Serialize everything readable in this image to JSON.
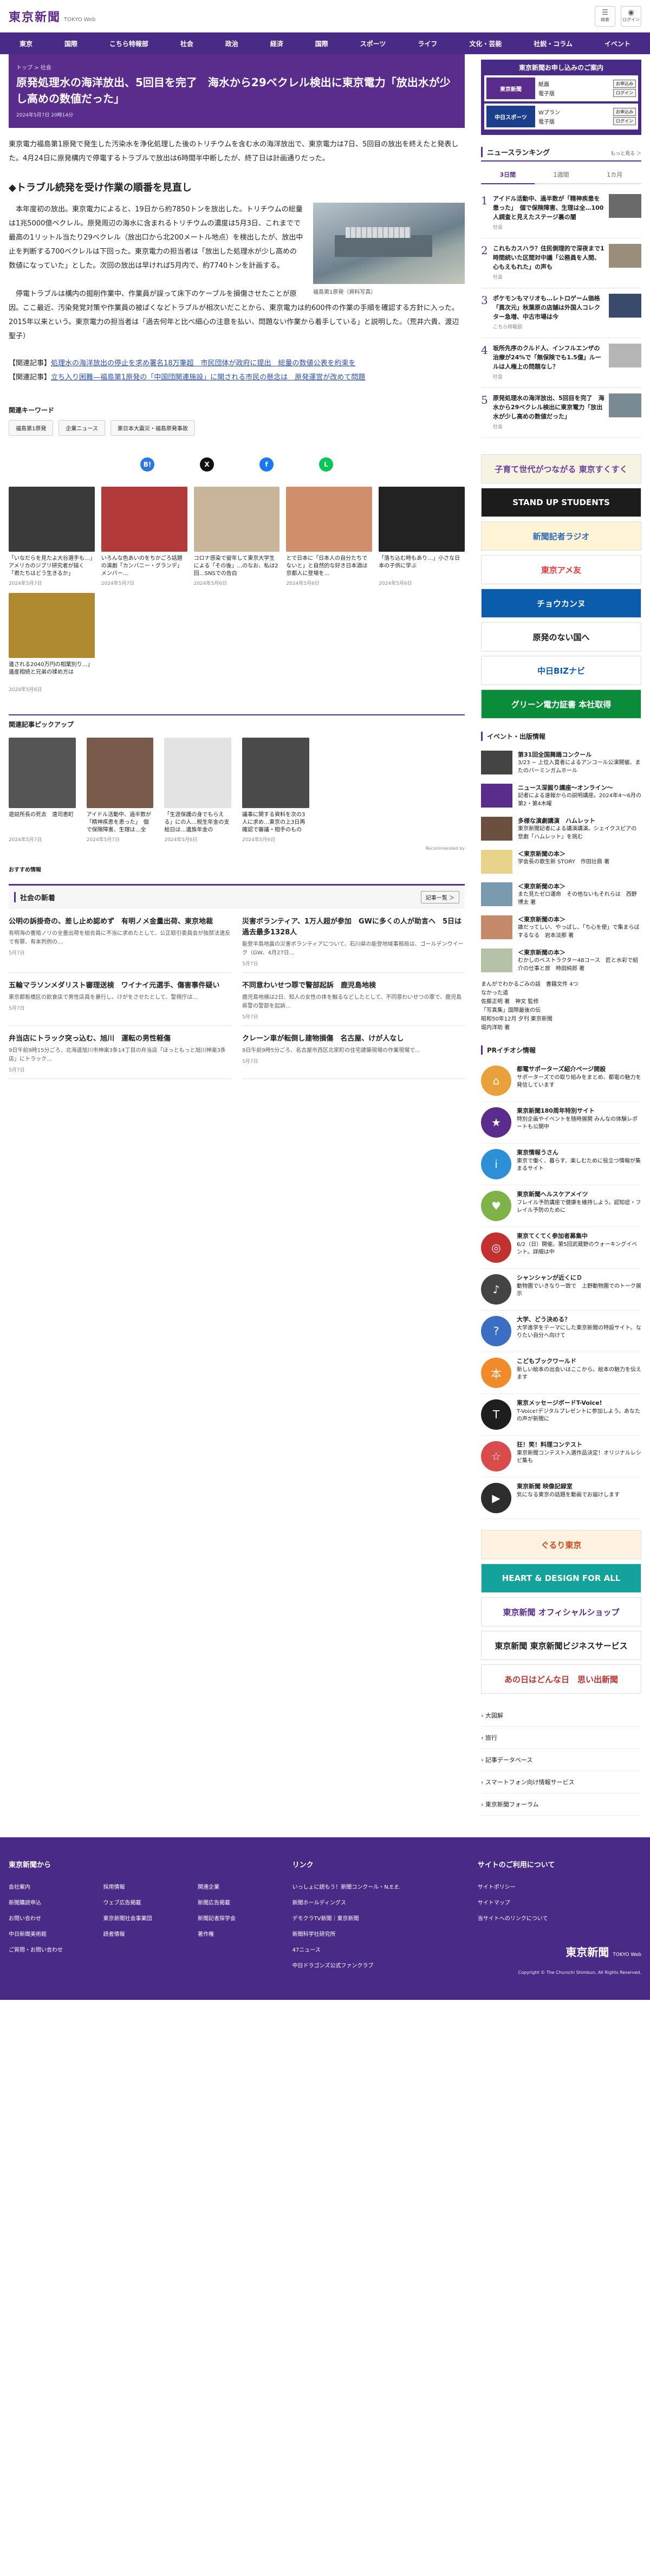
{
  "header": {
    "logo": "東京新聞",
    "logo_sub": "TOKYO Web",
    "icons": [
      {
        "glyph": "☰",
        "label": "検索"
      },
      {
        "glyph": "◉",
        "label": "ログイン"
      }
    ]
  },
  "nav": [
    "東京",
    "国際",
    "こちら特報部",
    "社会",
    "政治",
    "経済",
    "国際",
    "スポーツ",
    "ライフ",
    "文化・芸能",
    "社説・コラム",
    "イベント"
  ],
  "article": {
    "breadcrumb": "トップ > 社会",
    "title": "原発処理水の海洋放出、5回目を完了　海水から29ベクレル検出に東京電力「放出水が少し高めの数値だった」",
    "date": "2024年5月7日 20時14分",
    "lead": "東京電力福島第1原発で発生した汚染水を浄化処理した後のトリチウムを含む水の海洋放出で、東京電力は7日、5回目の放出を終えたと発表した。4月24日に原発構内で停電するトラブルで放出は6時間半中断したが、終了日は計画通りだった。",
    "section": "◆トラブル続発を受け作業の順番を見直し",
    "para1": "本年度初の放出。東京電力によると、19日から約7850トンを放出した。トリチウムの総量は1兆5000億ベクレル。原発周辺の海水に含まれるトリチウムの濃度は5月3日、これまでで最高の1リットル当たり29ベクレル（放出口から北200メートル地点）を検出したが、放出中止を判断する700ベクレルは下回った。東京電力の担当者は「放出した処理水が少し高めの数値になっていた」とした。次回の放出は早ければ5月内で、約7740トンを計画する。",
    "para2": "停電トラブルは構内の掘削作業中、作業員が誤って床下のケーブルを損傷させたことが原因。ここ最近、汚染発覚対策や作業員の被ばくなどトラブルが相次いだことから、東京電力は約600件の作業の手順を確認する方針に入った。2015年以来という。東京電力の担当者は「過去何年と比べ細心の注意を払い、問題ない作業から着手している」と説明した。（荒井六貴、渡辺聖子）",
    "photo_caption": "福島第1原発（資料写真）",
    "related": [
      {
        "tag": "【関連記事】",
        "text": "処理水の海洋放出の停止を求め署名18万筆超　市民団体が政府に提出　総量の数値公表を約束を"
      },
      {
        "tag": "【関連記事】",
        "text": "立ち入り困難—福島第1原発の「中国団関連施設」に関される市民の懸念は　原発運営が改めて問題"
      }
    ],
    "keywords_heading": "関連キーワード",
    "keywords": [
      "福島第1原発",
      "企業ニュース",
      "東日本大震災・福島原発事故"
    ]
  },
  "share": [
    {
      "g": "B!",
      "c": "#2c7ae0"
    },
    {
      "g": "X",
      "c": "#111"
    },
    {
      "g": "f",
      "c": "#1877f2"
    },
    {
      "g": "L",
      "c": "#06c755"
    }
  ],
  "photo_cards": [
    {
      "t": "「いなだらを見たよ大谷選手も…」アメリカのジブリ研究者が描く「君たちはどう生きるか」",
      "d": "2024年5月7日",
      "c": "#3a3a3a"
    },
    {
      "t": "いろんな色あいのをちかごろ話題の演劇「カンバニー・グランデ」メンバー…",
      "d": "2024年5月7日",
      "c": "#b23a3a"
    },
    {
      "t": "コロナ感染で留年して東京大学生による「その後」…のなお、私は2回…SNSでの告白",
      "d": "2024年5月6日",
      "c": "#c8b59a"
    },
    {
      "t": "とで日本に「日本人の自分たちでないと」と自然的な好き日本酒は京都人に登場を…",
      "d": "2024年5月6日",
      "c": "#d08f6a"
    },
    {
      "t": "「落ち込む時もあり…」小さな日本の子供に学ぶ",
      "d": "2024年5月6日",
      "c": "#222"
    },
    {
      "t": "遺される2040万円の相葉別り…」遺産相続と兄弟の揉め方は",
      "d": "2024年5月6日",
      "c": "#b08a30"
    }
  ],
  "pickup": {
    "heading": "関連記事ピックアップ",
    "items": [
      {
        "t": "遊説所長の死去　遠司恵町",
        "d": "2024年5月7日",
        "c": "#555"
      },
      {
        "t": "アイドル活動中、過半数が「精神疾患を患った」　個で保険障害、生理は…全100人聞き",
        "d": "2024年5月7日",
        "c": "#7a5a4a"
      },
      {
        "t": "「生涯保護の身でもらえる」にの人…税生年金の支給日は…遺族年金の",
        "d": "2024年5月6日",
        "c": "#e3e3e3"
      },
      {
        "t": "議事に関する資料を次の3人に求め…東京の上3日再確認で審議・相手のもの",
        "d": "2024年5月6日",
        "c": "#4a4a4a"
      }
    ],
    "reco": "Recommended by"
  },
  "osusume": "おすすめ情報",
  "social": {
    "heading": "社会の新着",
    "more": "記事一覧 ＞",
    "items": [
      {
        "h": "公明の訴掛奇の、差し止め認めず　有明ノメ金量出荷、東京地裁",
        "p": "有明海の養殖ノリの全量出荷を組合員に不当に求めたとして、公正取引委員会が独禁法違反で有罪、有本判例の…",
        "d": "5月7日"
      },
      {
        "h": "災害ボランティア、1万人超が参加　GWに多くの人が助言へ　5日は過去最多1328人",
        "p": "能登半島地震の災害ボランティアについて、石川県の能登地域事務局は、ゴールデンウイーク（GW、4月27日…",
        "d": "5月7日"
      },
      {
        "h": "五輪マラソンメダリスト審理送検　ワイナイ元選手、傷害事件疑い",
        "p": "東京都板橋区の飲食店で男性店員を暴行し、けがをさせたとして、警視庁は…",
        "d": "5月7日"
      },
      {
        "h": "不同意わいせつ罪で警部起訴　鹿児島地検",
        "p": "鹿児島地検は2日、知人の女性の体を触るなどしたとして、不同意わいせつの罪で、鹿児島県警の警部を起訴…",
        "d": "5月7日"
      },
      {
        "h": "弁当店にトラック突っ込む、旭川　運転の男性軽傷",
        "p": "9日午前9時15分ごろ、北海道旭川市神楽3条14丁目の弁当店「ほっともっと旭川神楽3条店」にトラック…",
        "d": "5月7日"
      },
      {
        "h": "クレーン車が転倒し建物損傷　名古屋、けが人なし",
        "p": "9日午前9時5分ごろ、名古屋市西区北家町の住宅建築現場の作業現場で…",
        "d": "5月7日"
      }
    ]
  },
  "side": {
    "banner": {
      "title": "東京新聞お申し込みのご案内",
      "rows": [
        {
          "logo": "東京新聞",
          "opts": [
            {
              "n": "紙面",
              "b": "お申込み"
            },
            {
              "n": "電子版",
              "b": "ログイン"
            }
          ]
        },
        {
          "logo": "中日スポーツ",
          "opts": [
            {
              "n": "Wプラン",
              "b": "お申込み"
            },
            {
              "n": "電子版",
              "b": "ログイン"
            }
          ]
        }
      ]
    },
    "ranking": {
      "heading": "ニュースランキング",
      "more": "もっと見る ＞",
      "tabs": [
        "3日間",
        "1週間",
        "1カ月"
      ],
      "items": [
        {
          "n": "1",
          "t": "アイドル活動中、過半数が「精神疾患を患った」　個で保険障害、生理は全…100人調査と見えたステージ裏の闇",
          "c": "社会"
        },
        {
          "n": "2",
          "t": "これもカスハラ？住民側理的で深夜まで1時間続いた区間対中議「公務員を人間、心もえもれた」の声も",
          "c": "社会"
        },
        {
          "n": "3",
          "t": "ポケモンもマリオも…レトロゲーム価格「異次元」秋葉原の店舗は外国人コレクター急増、中古市場は今",
          "c": "こちら特報部"
        },
        {
          "n": "4",
          "t": "坂所先序のクルド人、インフルエンザの治療が24%で「無保険でも1.5億」ルールは人権上の問題なし？",
          "c": "社会"
        },
        {
          "n": "5",
          "t": "原発処理水の海洋放出、5回目を完了　海水から29ベクレル検出に東京電力「放出水が少し高めの数値だった」",
          "c": "社会"
        }
      ]
    },
    "banners": [
      {
        "t": "子育て世代がつながる 東京すくすく",
        "bg": "#f7f3e3",
        "fg": "#6a3f9a"
      },
      {
        "t": "STAND UP STUDENTS",
        "bg": "#1c1c1c",
        "fg": "#fff"
      },
      {
        "t": "新聞記者ラジオ",
        "bg": "#fff4d6",
        "fg": "#2d6ab8"
      },
      {
        "t": "東京アメ友",
        "bg": "#fff",
        "fg": "#e23c3c"
      },
      {
        "t": "チョウカンヌ",
        "bg": "#0b5cad",
        "fg": "#fff"
      },
      {
        "t": "原発のない国へ",
        "bg": "#fff",
        "fg": "#1b1b1b"
      },
      {
        "t": "中日BIZナビ",
        "bg": "#fff",
        "fg": "#0b5cad"
      },
      {
        "t": "グリーン電力証書 本社取得",
        "bg": "#0b8c3a",
        "fg": "#fff"
      }
    ],
    "events": {
      "heading": "イベント・出版情報",
      "items": [
        {
          "t": "第31回全国舞踊コンクール",
          "p": "3/23 − 上位入賞者によるアンコール公演開催、またのバーミンガムホール",
          "c": "#444"
        },
        {
          "t": "ニュース深掘り講座〜オンライン〜",
          "p": "記者による速報からの説明講座。2024年4〜6月の第2・第4木曜",
          "c": "#5a2d8c"
        },
        {
          "t": "多様な演劇講演　ハムレット",
          "p": "東京新聞記者による講演講演。シェイクスピアの悲劇「ハムレット」を挑む",
          "c": "#6b5040"
        },
        {
          "t": "＜東京新聞の本＞",
          "p": "学会長の歌生新 STORY　作田壮鼎 著",
          "c": "#e8d38a"
        },
        {
          "t": "＜東京新聞の本＞",
          "p": "また見たゼロ運命　その他ないもそれらは　西野博太 著",
          "c": "#7a9ab0"
        },
        {
          "t": "＜東京新聞の本＞",
          "p": "誰だってしい、やっぱし、「ち心を使」で集まらばするなる　岩本淡那 著",
          "c": "#c58a6a"
        },
        {
          "t": "＜東京新聞の本＞",
          "p": "むかしのベストラクター48コース　匠と水彩で紹介の仕事と旅　時田純郎 著",
          "c": "#b6c2a8"
        }
      ],
      "extra": [
        "まんがでわかるごみの話　書籍文件 4つ",
        "なかった道",
        "佐藤正明 著　神文 監修",
        "「写真集」国際最後の伝",
        "昭和50年12月 夕刊 東京新聞",
        "堀内洋助 著"
      ]
    },
    "pr": {
      "heading": "PRイチオシ情報",
      "items": [
        {
          "t": "都電サポーターズ紹介ページ開設",
          "p": "サポーターズでの取り組みをまとめ、都電の魅力を発信しています",
          "c": "#e9a23b",
          "g": "⌂"
        },
        {
          "t": "東京新聞180周年特別サイト",
          "p": "特別企画やイベントを随時展開 みんなの体験レポートも公開中",
          "c": "#5a2d8c",
          "g": "★"
        },
        {
          "t": "東京情報うさん",
          "p": "東京で働く、暮らす、楽しむために役立つ情報が集まるサイト",
          "c": "#2d8fd5",
          "g": "i"
        },
        {
          "t": "東京新聞ヘルスケアメイツ",
          "p": "フレイル予防講座で健康を維持しよう。認知症・フレイル予防のために",
          "c": "#7fb34a",
          "g": "♥"
        },
        {
          "t": "東京てくてく参加者募集中",
          "p": "6/2（日）開催。第5回武蔵野のウォーキングイベント。詳細は中",
          "c": "#c23030",
          "g": "◎"
        },
        {
          "t": "シャンシャンが近くにＤ",
          "p": "動物園でいきなり一致で　上野動物園でのトーク展示",
          "c": "#444",
          "g": "♪"
        },
        {
          "t": "大学、どう決める？",
          "p": "大学進学をテーマにした東京新聞の特設サイト。なりたい自分へ向けて",
          "c": "#3a6fc4",
          "g": "?"
        },
        {
          "t": "こどもブックワールド",
          "p": "新しい絵本の出会いはここから。絵本の魅力を伝えます",
          "c": "#f08a2b",
          "g": "本"
        },
        {
          "t": "東京メッセージボードT-Voice!",
          "p": "T-Voice!デジタルプレゼントに参加しよう。あなたの声が新聞に",
          "c": "#1e1e1e",
          "g": "T"
        },
        {
          "t": "狂！笑！料理コンテスト",
          "p": "東京新聞コンテスト入選作品決定！オリジナルレシピ集も",
          "c": "#d94c4c",
          "g": "☆"
        },
        {
          "t": "東京新聞 映像記録室",
          "p": "気になる東京の話題を動画でお届けします",
          "c": "#2d2d2d",
          "g": "▶"
        }
      ]
    },
    "banners2": [
      {
        "t": "ぐるり東京",
        "bg": "#fff2e0",
        "fg": "#d04a1a"
      },
      {
        "t": "HEART & DESIGN FOR ALL",
        "bg": "#13a39c",
        "fg": "#fff"
      },
      {
        "t": "東京新聞 オフィシャルショップ",
        "bg": "#fff",
        "fg": "#5a2d8c"
      },
      {
        "t": "東京新聞 東京新聞ビジネスサービス",
        "bg": "#fff",
        "fg": "#222"
      },
      {
        "t": "あの日はどんな日　思い出新聞",
        "bg": "#fff",
        "fg": "#b33"
      }
    ],
    "links": [
      "大図解",
      "旅行",
      "記事データベース",
      "スマートフォン向け情報サービス",
      "東京新聞フォーラム"
    ]
  },
  "footer": {
    "col1": {
      "h": "東京新聞から",
      "links": [
        [
          "会社案内",
          "採用情報",
          "関連企業"
        ],
        [
          "新聞購読申込",
          "ウェブ広告掲載",
          "新聞広告掲載"
        ],
        [
          "お問い合わせ",
          "東京新聞社会事業団",
          "新聞記者探学会"
        ],
        [
          "中日新聞美術館",
          "読者情報",
          "著作権"
        ],
        [
          "ご質問・お問い合わせ"
        ]
      ]
    },
    "col2": {
      "h": "リンク",
      "links": [
        "いっしょに読もう！新聞コンクール・N.E.E.",
        "新聞ホールディングス",
        "デモクラTV新聞｜東京新聞",
        "新聞科学社研究所",
        "47ニュース",
        "中日ドラゴンズ公式ファンクラブ"
      ]
    },
    "col3": {
      "h": "サイトのご利用について",
      "links": [
        "サイトポリシー",
        "サイトマップ",
        "当サイトへのリンクについて"
      ]
    },
    "logo": "東京新聞",
    "logo_sub": "TOKYO Web",
    "copy": "Copyright © The Chunichi Shimbun, All Rights Reserved."
  }
}
